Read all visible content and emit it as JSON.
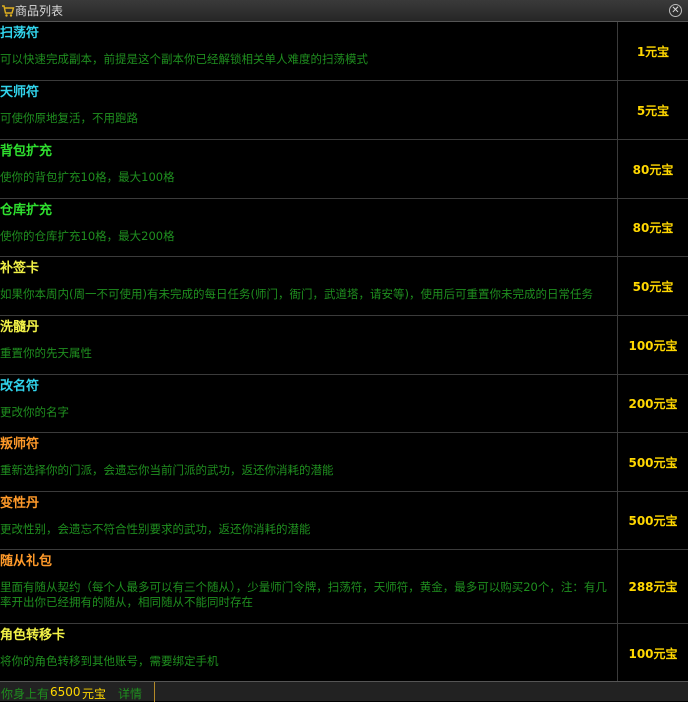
{
  "window": {
    "title": "商品列表",
    "icon": "shopping-cart-icon",
    "close_icon": "close-icon",
    "close_glyph": "✕"
  },
  "colors": {
    "cyan": "#31d4ec",
    "green": "#2fe02f",
    "yellow": "#f2f247",
    "orange": "#ff9a2a",
    "desc": "#1f8f1f",
    "price": "#ffd700"
  },
  "items": [
    {
      "name": "扫荡符",
      "color": "cyan",
      "desc": "可以快速完成副本，前提是这个副本你已经解锁相关单人难度的扫荡模式",
      "price": "1元宝"
    },
    {
      "name": "天师符",
      "color": "cyan",
      "desc": "可使你原地复活，不用跑路",
      "price": "5元宝"
    },
    {
      "name": "背包扩充",
      "color": "green",
      "desc": "使你的背包扩充10格，最大100格",
      "price": "80元宝"
    },
    {
      "name": "仓库扩充",
      "color": "green",
      "desc": "使你的仓库扩充10格，最大200格",
      "price": "80元宝"
    },
    {
      "name": "补签卡",
      "color": "yellow",
      "desc": "如果你本周内(周一不可使用)有未完成的每日任务(师门，衙门，武道塔，请安等)，使用后可重置你未完成的日常任务",
      "price": "50元宝"
    },
    {
      "name": "洗髓丹",
      "color": "yellow",
      "desc": "重置你的先天属性",
      "price": "100元宝"
    },
    {
      "name": "改名符",
      "color": "cyan",
      "desc": "更改你的名字",
      "price": "200元宝"
    },
    {
      "name": "叛师符",
      "color": "orange",
      "desc": "重新选择你的门派，会遗忘你当前门派的武功，返还你消耗的潜能",
      "price": "500元宝"
    },
    {
      "name": "变性丹",
      "color": "orange",
      "desc": "更改性别，会遗忘不符合性别要求的武功，返还你消耗的潜能",
      "price": "500元宝"
    },
    {
      "name": "随从礼包",
      "color": "orange",
      "desc": "里面有随从契约（每个人最多可以有三个随从），少量师门令牌，扫荡符，天师符，黄金，最多可以购买20个，注：有几率开出你已经拥有的随从，相同随从不能同时存在",
      "price": "288元宝"
    },
    {
      "name": "角色转移卡",
      "color": "yellow",
      "desc": "将你的角色转移到其他账号，需要绑定手机",
      "price": "100元宝"
    }
  ],
  "footer": {
    "label": "你身上有",
    "amount": "6500",
    "unit": "元宝",
    "detail_link": "详情"
  }
}
